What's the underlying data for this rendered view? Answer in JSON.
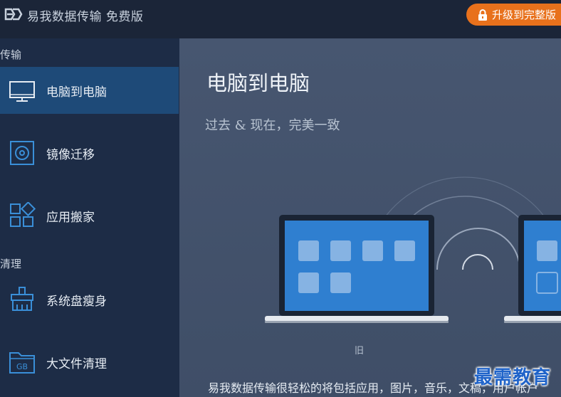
{
  "titlebar": {
    "app_title": "易我数据传输 免费版",
    "upgrade_label": "升级到完整版"
  },
  "sidebar": {
    "sections": [
      {
        "label": "传输"
      },
      {
        "label": "清理"
      }
    ],
    "items": [
      {
        "label": "电脑到电脑",
        "icon": "monitor-icon",
        "active": true
      },
      {
        "label": "镜像迁移",
        "icon": "disk-image-icon",
        "active": false
      },
      {
        "label": "应用搬家",
        "icon": "apps-grid-icon",
        "active": false
      },
      {
        "label": "系统盘瘦身",
        "icon": "broom-icon",
        "active": false
      },
      {
        "label": "大文件清理",
        "icon": "gb-folder-icon",
        "active": false
      }
    ]
  },
  "main": {
    "title": "电脑到电脑",
    "tagline": "过去 & 现在，完美一致",
    "old_pc_label": "旧",
    "description": "易我数据传输很轻松的将包括应用，图片，音乐，文稿，用户帐户"
  },
  "watermark": "最需教育",
  "colors": {
    "accent_orange": "#e8711c",
    "active_item": "#1e4a78",
    "sidebar_bg": "#1d2c46",
    "main_bg": "#475670",
    "screen_blue": "#2f7fd0"
  }
}
